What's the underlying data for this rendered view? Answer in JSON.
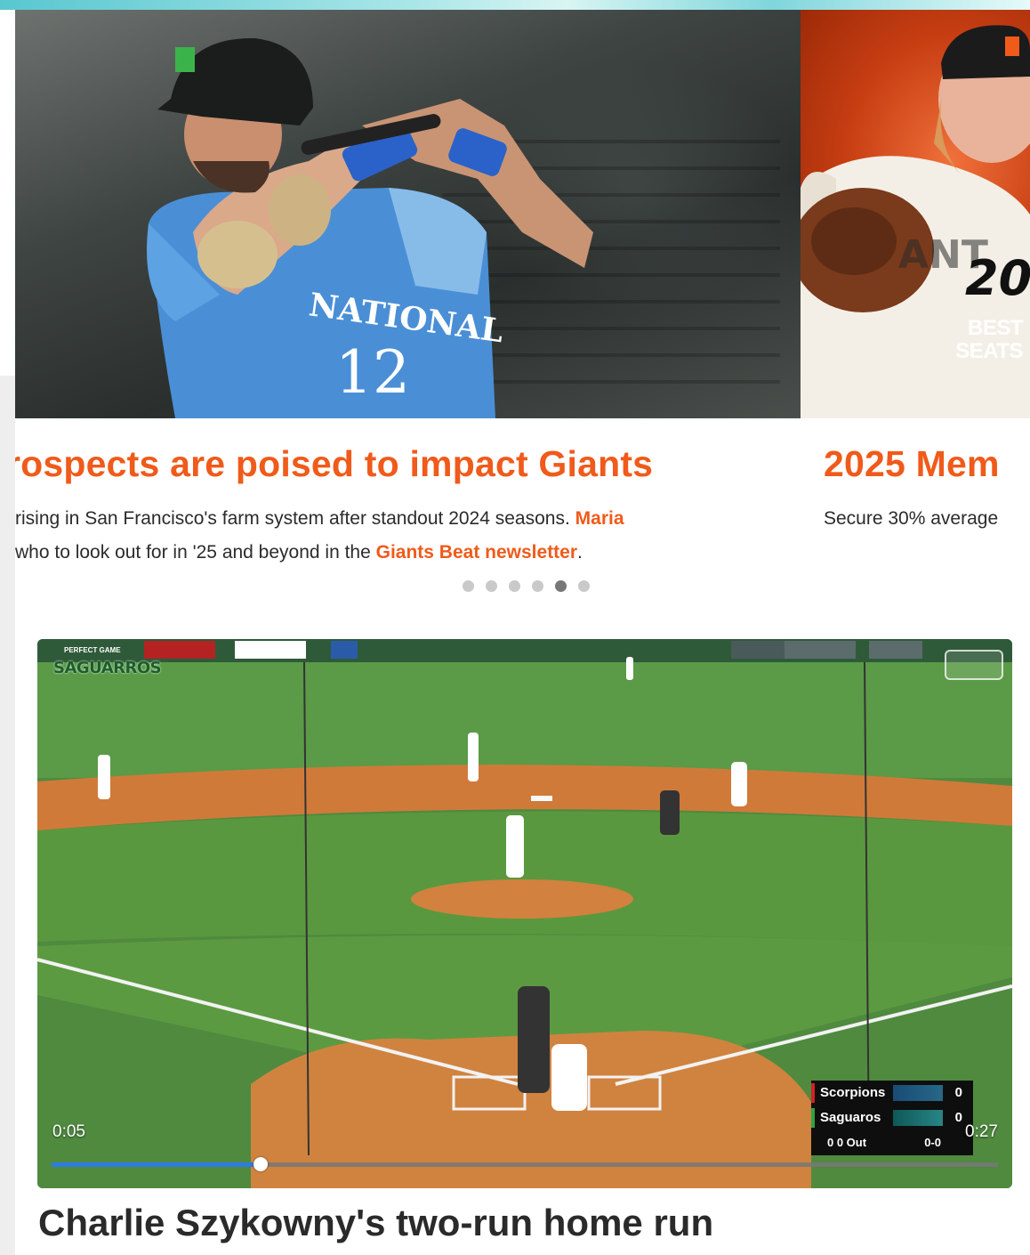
{
  "carousel": {
    "slides": [
      {
        "title": "rospects are poised to impact Giants",
        "desc_line1": " rising in San Francisco's farm system after standout 2024 seasons. ",
        "desc_link1": "Maria",
        "desc_line2_a": "who to look out for in '25 and beyond in the ",
        "desc_link2": "Giants Beat newsletter",
        "desc_line2_b": ".",
        "image": "baseball-batter-photo",
        "jersey_text": "NATIONAL",
        "jersey_number": "12"
      },
      {
        "title": "2025 Mem",
        "desc_line1": "Secure 30% average",
        "image": "pitcher-promo-photo",
        "promo_line1": "BEST",
        "promo_line2": "SEATS",
        "promo_number": "20"
      }
    ],
    "dots_count": 6,
    "active_dot": 5
  },
  "video": {
    "current_time": "0:05",
    "total_time": "0:27",
    "progress_fraction": 0.221,
    "overlay_team_logo": "SAGUARROS",
    "overlay_banner": "PERFECT GAME",
    "scorebug": {
      "team1": "Scorpions",
      "score1": "0",
      "team2": "Saguaros",
      "score2": "0",
      "outs": "0   0 Out",
      "count": "0-0"
    },
    "title": "Charlie Szykowny's two-run home run"
  },
  "colors": {
    "accent": "#f05a1a",
    "progress": "#2b7de0"
  }
}
